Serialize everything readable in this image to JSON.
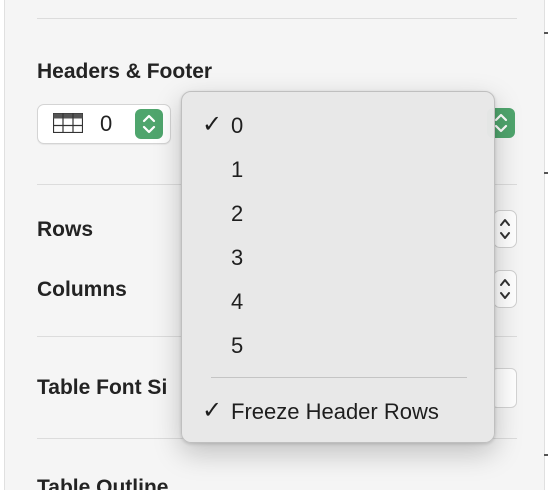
{
  "panel": {
    "headers_footer_label": "Headers & Footer",
    "header_rows_value": "0",
    "rows_label": "Rows",
    "columns_label": "Columns",
    "table_font_size_label": "Table Font Si",
    "table_outline_label": "Table Outline"
  },
  "icons": {
    "table_grid": "table-grid-icon",
    "stepper": "up-down-chevron-icon",
    "checkmark": "checkmark-icon"
  },
  "menu": {
    "items": [
      {
        "label": "0",
        "checked": true
      },
      {
        "label": "1",
        "checked": false
      },
      {
        "label": "2",
        "checked": false
      },
      {
        "label": "3",
        "checked": false
      },
      {
        "label": "4",
        "checked": false
      },
      {
        "label": "5",
        "checked": false
      }
    ],
    "freeze_label": "Freeze Header Rows",
    "freeze_checked": true,
    "check_glyph": "✓"
  },
  "colors": {
    "accent_green": "#4fa56d",
    "panel_bg": "#f5f5f5",
    "menu_bg": "#e8e8e8"
  }
}
